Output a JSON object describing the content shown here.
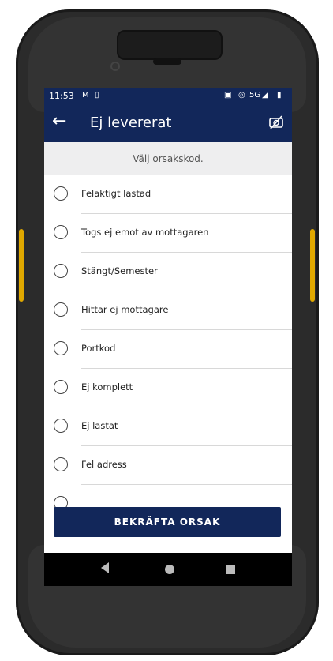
{
  "status_bar": {
    "time": "11:53",
    "network": "5G"
  },
  "app_bar": {
    "title": "Ej levererat",
    "back_icon": "arrow-left-icon",
    "action_icon": "no-camera-icon"
  },
  "hint_text": "Välj orsakskod.",
  "reasons": [
    {
      "label": "Felaktigt lastad"
    },
    {
      "label": "Togs ej emot av mottagaren"
    },
    {
      "label": "Stängt/Semester"
    },
    {
      "label": "Hittar ej mottagare"
    },
    {
      "label": "Portkod"
    },
    {
      "label": "Ej komplett"
    },
    {
      "label": "Ej lastat"
    },
    {
      "label": "Fel adress"
    },
    {
      "label": ""
    }
  ],
  "confirm_button": "BEKRÄFTA ORSAK",
  "colors": {
    "brand": "#12275a",
    "hint_bg": "#eeeeef"
  }
}
